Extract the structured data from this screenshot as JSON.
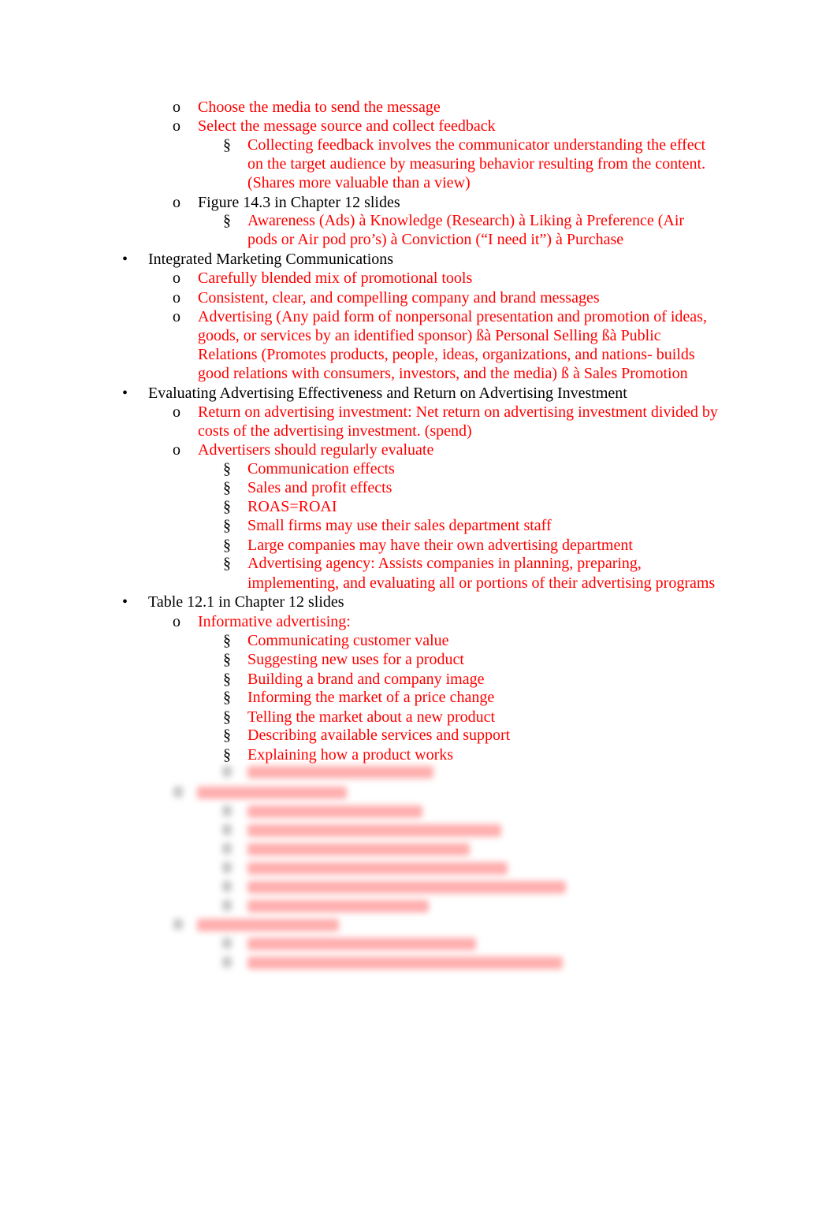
{
  "document": {
    "markers": {
      "bullet": "•",
      "circle": "o",
      "section": "§"
    },
    "lines": [
      {
        "level": 2,
        "marker": "o",
        "color": "red",
        "text": "Choose the media to send the message"
      },
      {
        "level": 2,
        "marker": "o",
        "color": "red",
        "text": "Select the message source and collect feedback"
      },
      {
        "level": 3,
        "marker": "§",
        "color": "red",
        "text": "Collecting feedback involves the communicator understanding the effect"
      },
      {
        "level": 3,
        "marker": "",
        "color": "red",
        "text": "on the target audience by measuring behavior resulting from the content."
      },
      {
        "level": 3,
        "marker": "",
        "color": "red",
        "text": "(Shares more valuable than a view)"
      },
      {
        "level": 2,
        "marker": "o",
        "color": "black",
        "text": "Figure 14.3 in Chapter 12 slides"
      },
      {
        "level": 3,
        "marker": "§",
        "color": "red",
        "text": "Awareness (Ads) à   Knowledge (Research) à   Liking à   Preference (Air"
      },
      {
        "level": 3,
        "marker": "",
        "color": "red",
        "text": "pods or Air pod pro’s) à   Conviction (“I need it”) à   Purchase"
      },
      {
        "level": 1,
        "marker": "•",
        "color": "black",
        "text": "Integrated Marketing Communications"
      },
      {
        "level": 2,
        "marker": "o",
        "color": "red",
        "text": "Carefully blended mix of promotional tools"
      },
      {
        "level": 2,
        "marker": "o",
        "color": "red",
        "text": "Consistent, clear, and compelling company and brand messages"
      },
      {
        "level": 2,
        "marker": "o",
        "color": "red",
        "text": "Advertising (Any paid form of nonpersonal presentation and promotion of ideas,"
      },
      {
        "level": 2,
        "marker": "",
        "color": "red",
        "text": "goods, or services by an identified sponsor) ßà     Personal Selling ßà     Public"
      },
      {
        "level": 2,
        "marker": "",
        "color": "red",
        "text": "Relations (Promotes products, people, ideas, organizations, and nations- builds"
      },
      {
        "level": 2,
        "marker": "",
        "color": "red",
        "text": "good relations with consumers, investors, and the media) ß   à   Sales Promotion"
      },
      {
        "level": 1,
        "marker": "•",
        "color": "black",
        "text": "Evaluating Advertising Effectiveness and Return on Advertising Investment"
      },
      {
        "level": 2,
        "marker": "o",
        "color": "red",
        "text": "Return on advertising investment: Net return on advertising investment divided by"
      },
      {
        "level": 2,
        "marker": "",
        "color": "red",
        "text": "costs of the advertising investment. (spend)"
      },
      {
        "level": 2,
        "marker": "o",
        "color": "red",
        "text": "Advertisers should regularly evaluate"
      },
      {
        "level": 3,
        "marker": "§",
        "color": "red",
        "text": "Communication effects"
      },
      {
        "level": 3,
        "marker": "§",
        "color": "red",
        "text": "Sales and profit effects"
      },
      {
        "level": 3,
        "marker": "§",
        "color": "red",
        "text": "ROAS=ROAI"
      },
      {
        "level": 3,
        "marker": "§",
        "color": "red",
        "text": "Small firms may use their sales department staff"
      },
      {
        "level": 3,
        "marker": "§",
        "color": "red",
        "text": "Large companies may have their own advertising department"
      },
      {
        "level": 3,
        "marker": "§",
        "color": "red",
        "text": "Advertising agency: Assists companies in planning, preparing,"
      },
      {
        "level": 3,
        "marker": "",
        "color": "red",
        "text": "implementing, and evaluating all or portions of their advertising programs"
      },
      {
        "level": 1,
        "marker": "•",
        "color": "black",
        "text": "Table 12.1 in Chapter 12 slides"
      },
      {
        "level": 2,
        "marker": "o",
        "color": "red",
        "text": "Informative advertising:"
      },
      {
        "level": 3,
        "marker": "§",
        "color": "red",
        "text": "Communicating customer value"
      },
      {
        "level": 3,
        "marker": "§",
        "color": "red",
        "text": " Suggesting new uses for a product"
      },
      {
        "level": 3,
        "marker": "§",
        "color": "red",
        "text": "Building a brand and company image"
      },
      {
        "level": 3,
        "marker": "§",
        "color": "red",
        "text": "Informing the market of a price change"
      },
      {
        "level": 3,
        "marker": "§",
        "color": "red",
        "text": "Telling the market about a new product"
      },
      {
        "level": 3,
        "marker": "§",
        "color": "red",
        "text": "Describing available services and support"
      },
      {
        "level": 3,
        "marker": "§",
        "color": "red",
        "text": "Explaining how a product works"
      }
    ],
    "colors": {
      "red": "#ff0000",
      "black": "#000000"
    }
  }
}
